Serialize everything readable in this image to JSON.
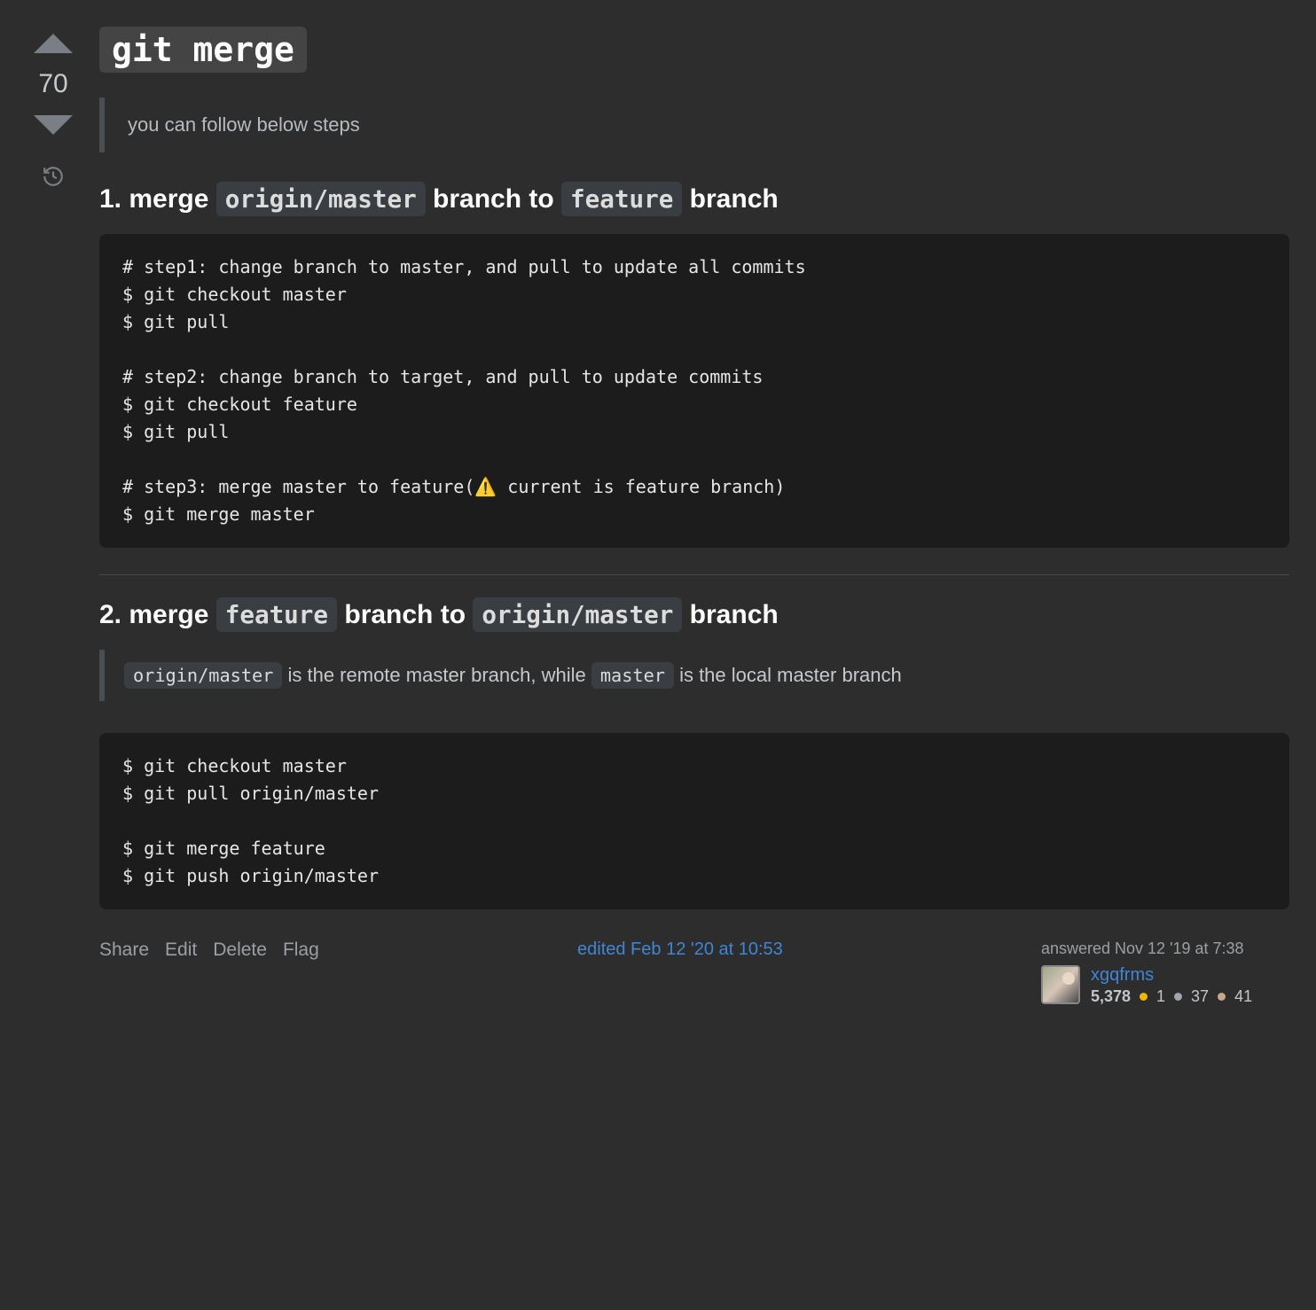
{
  "vote": {
    "score": "70"
  },
  "answer": {
    "title_code": "git merge",
    "intro_quote": "you can follow below steps",
    "section1": {
      "prefix": "1. merge ",
      "code1": "origin/master",
      "mid": " branch to ",
      "code2": "feature",
      "suffix": " branch"
    },
    "codeblock1": "# step1: change branch to master, and pull to update all commits\n$ git checkout master\n$ git pull\n\n# step2: change branch to target, and pull to update commits\n$ git checkout feature\n$ git pull\n\n# step3: merge master to feature(⚠️ current is feature branch)\n$ git merge master",
    "section2": {
      "prefix": "2. merge ",
      "code1": "feature",
      "mid": " branch to ",
      "code2": "origin/master",
      "suffix": " branch"
    },
    "note": {
      "code1": "origin/master",
      "text1": " is the remote master branch, while ",
      "code2": "master",
      "text2": " is the local master branch"
    },
    "codeblock2": "$ git checkout master\n$ git pull origin/master\n\n$ git merge feature\n$ git push origin/master"
  },
  "actions": {
    "share": "Share",
    "edit": "Edit",
    "delete": "Delete",
    "flag": "Flag"
  },
  "edited": {
    "text": "edited Feb 12 '20 at 10:53"
  },
  "user": {
    "answered": "answered Nov 12 '19 at 7:38",
    "name": "xgqfrms",
    "reputation": "5,378",
    "gold": "1",
    "silver": "37",
    "bronze": "41"
  }
}
